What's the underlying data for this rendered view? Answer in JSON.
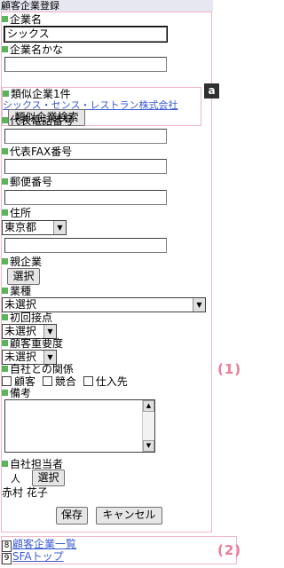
{
  "header": {
    "title": "顧客企業登録"
  },
  "form": {
    "company_name_label": "企業名",
    "company_name_value": "シックス",
    "company_kana_label": "企業名かな",
    "company_kana_value": "",
    "similar": {
      "label": "類似企業1件",
      "result_link": "シックス・センス・レストラン株式会社",
      "search_button": "類似企業検索"
    },
    "phone_label": "代表電話番号",
    "fax_label": "代表FAX番号",
    "zip_label": "郵便番号",
    "address_label": "住所",
    "prefecture_value": "東京都",
    "parent_label": "親企業",
    "parent_select_button": "選択",
    "industry_label": "業種",
    "industry_value": "未選択",
    "first_contact_label": "初回接点",
    "first_contact_value": "未選択",
    "importance_label": "顧客重要度",
    "importance_value": "未選択",
    "relation_label": "自社との関係",
    "relation_options": [
      "顧客",
      "競合",
      "仕入先"
    ],
    "notes_label": "備考",
    "owner_label": "自社担当者",
    "owner_prefix": "人",
    "owner_select_button": "選択",
    "owner_name": "赤村 花子",
    "save_button": "保存",
    "cancel_button": "キャンセル"
  },
  "footer": {
    "links": [
      {
        "key": "8",
        "label": "顧客企業一覧"
      },
      {
        "key": "9",
        "label": "SFAトップ"
      }
    ]
  },
  "annotations": {
    "badge_a": "a",
    "region_1": "(1)",
    "region_2": "(2)"
  },
  "colors": {
    "accent_pink": "#ee7a98",
    "bullet_green": "#5ab45a",
    "link_blue": "#3b5bd6",
    "title_bg": "#e7e7f2"
  }
}
